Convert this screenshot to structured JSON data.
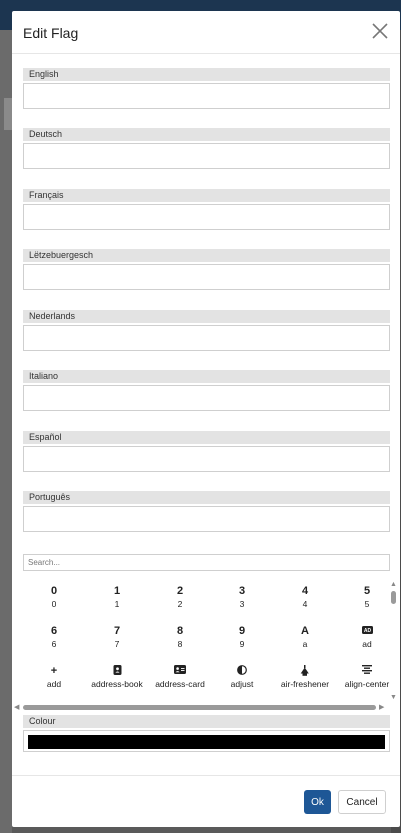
{
  "dialog": {
    "title": "Edit Flag",
    "close_icon": "close-icon"
  },
  "languages": [
    {
      "label": "English",
      "value": ""
    },
    {
      "label": "Deutsch",
      "value": ""
    },
    {
      "label": "Français",
      "value": ""
    },
    {
      "label": "Lëtzebuergesch",
      "value": ""
    },
    {
      "label": "Nederlands",
      "value": ""
    },
    {
      "label": "Italiano",
      "value": ""
    },
    {
      "label": "Español",
      "value": ""
    },
    {
      "label": "Português",
      "value": ""
    }
  ],
  "icon_picker": {
    "search_placeholder": "Search...",
    "icons": [
      {
        "glyph": "0",
        "name": "0"
      },
      {
        "glyph": "1",
        "name": "1"
      },
      {
        "glyph": "2",
        "name": "2"
      },
      {
        "glyph": "3",
        "name": "3"
      },
      {
        "glyph": "4",
        "name": "4"
      },
      {
        "glyph": "5",
        "name": "5"
      },
      {
        "glyph": "6",
        "name": "6"
      },
      {
        "glyph": "7",
        "name": "7"
      },
      {
        "glyph": "8",
        "name": "8"
      },
      {
        "glyph": "9",
        "name": "9"
      },
      {
        "glyph": "A",
        "name": "a"
      },
      {
        "glyph": "ad-icon",
        "name": "ad"
      },
      {
        "glyph": "+",
        "name": "add"
      },
      {
        "glyph": "address-book-icon",
        "name": "address-book"
      },
      {
        "glyph": "address-card-icon",
        "name": "address-card"
      },
      {
        "glyph": "adjust-icon",
        "name": "adjust"
      },
      {
        "glyph": "air-freshener-icon",
        "name": "air-freshener"
      },
      {
        "glyph": "align-center-icon",
        "name": "align-center"
      }
    ]
  },
  "colour": {
    "label": "Colour",
    "value": "#000000"
  },
  "footer": {
    "ok_label": "Ok",
    "cancel_label": "Cancel"
  },
  "theme": {
    "primary": "#1e5796",
    "header_bg": "#1c3550",
    "label_bg": "#e3e3e3"
  }
}
